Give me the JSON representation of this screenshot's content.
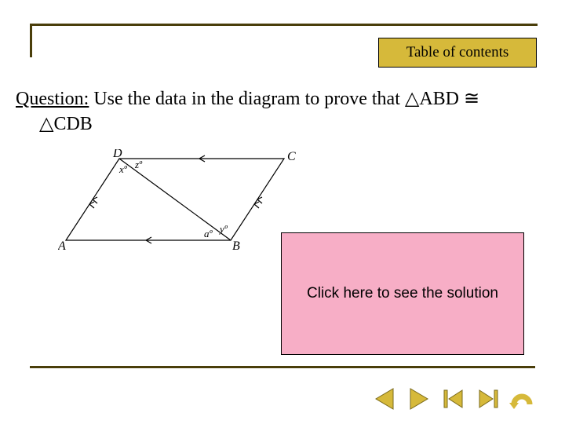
{
  "toc": {
    "label": "Table of contents"
  },
  "question": {
    "label": "Question:",
    "text_before": " Use the data in the diagram to prove that ",
    "tri1": "ABD",
    "congr": " ≅",
    "tri2": "CDB"
  },
  "diagram": {
    "labels": {
      "D": "D",
      "C": "C",
      "A": "A",
      "B": "B",
      "x": "xº",
      "z": "zº",
      "a": "aº",
      "y": "yº"
    }
  },
  "solution": {
    "prompt": "Click here to see the solution"
  },
  "nav": {
    "prev": "prev-icon",
    "next": "next-icon",
    "first": "first-icon",
    "last": "last-icon",
    "back": "back-icon"
  },
  "colors": {
    "accent": "#d6b93a",
    "frame": "#4a3e0a",
    "pink": "#f7aec6"
  }
}
